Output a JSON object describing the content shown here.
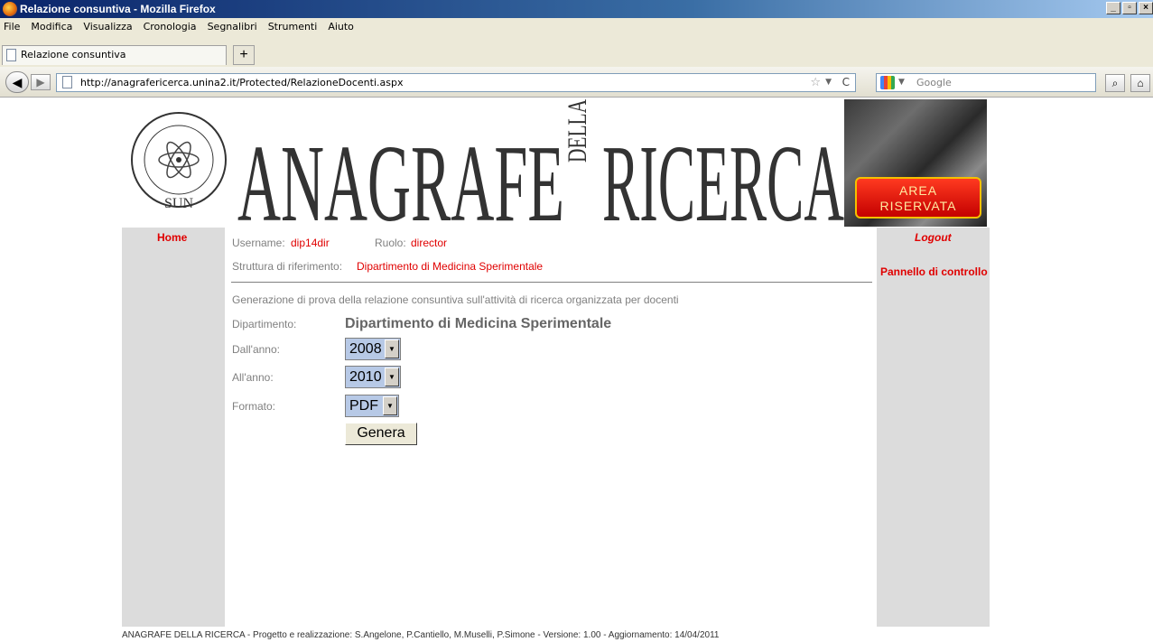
{
  "window": {
    "title": "Relazione consuntiva - Mozilla Firefox"
  },
  "menu": [
    "File",
    "Modifica",
    "Visualizza",
    "Cronologia",
    "Segnalibri",
    "Strumenti",
    "Aiuto"
  ],
  "tab": {
    "label": "Relazione consuntiva",
    "new_tab": "+"
  },
  "nav": {
    "url": "http://anagrafericerca.unina2.it/Protected/RelazioneDocenti.aspx",
    "search_placeholder": "Google"
  },
  "banner": {
    "title_main": "ANAGRAFE",
    "title_small": "DELLA",
    "title_end": "RICERCA",
    "seal_text": "SUN",
    "area_line1": "AREA",
    "area_line2": "RISERVATA"
  },
  "sidebar": {
    "home": "Home"
  },
  "rightbar": {
    "logout": "Logout",
    "pannello": "Pannello di controllo"
  },
  "user": {
    "username_label": "Username:",
    "username": "dip14dir",
    "ruolo_label": "Ruolo:",
    "ruolo": "director",
    "struttura_label": "Struttura di riferimento:",
    "struttura": "Dipartimento di Medicina Sperimentale"
  },
  "form": {
    "description": "Generazione di prova della relazione consuntiva sull'attività di ricerca organizzata per docenti",
    "dipartimento_label": "Dipartimento:",
    "dipartimento": "Dipartimento di Medicina Sperimentale",
    "dall_label": "Dall'anno:",
    "dall_value": "2008",
    "all_label": "All'anno:",
    "all_value": "2010",
    "formato_label": "Formato:",
    "formato_value": "PDF",
    "genera": "Genera"
  },
  "footer": "ANAGRAFE DELLA RICERCA - Progetto e realizzazione: S.Angelone, P.Cantiello, M.Muselli, P.Simone - Versione: 1.00 - Aggiornamento: 14/04/2011"
}
